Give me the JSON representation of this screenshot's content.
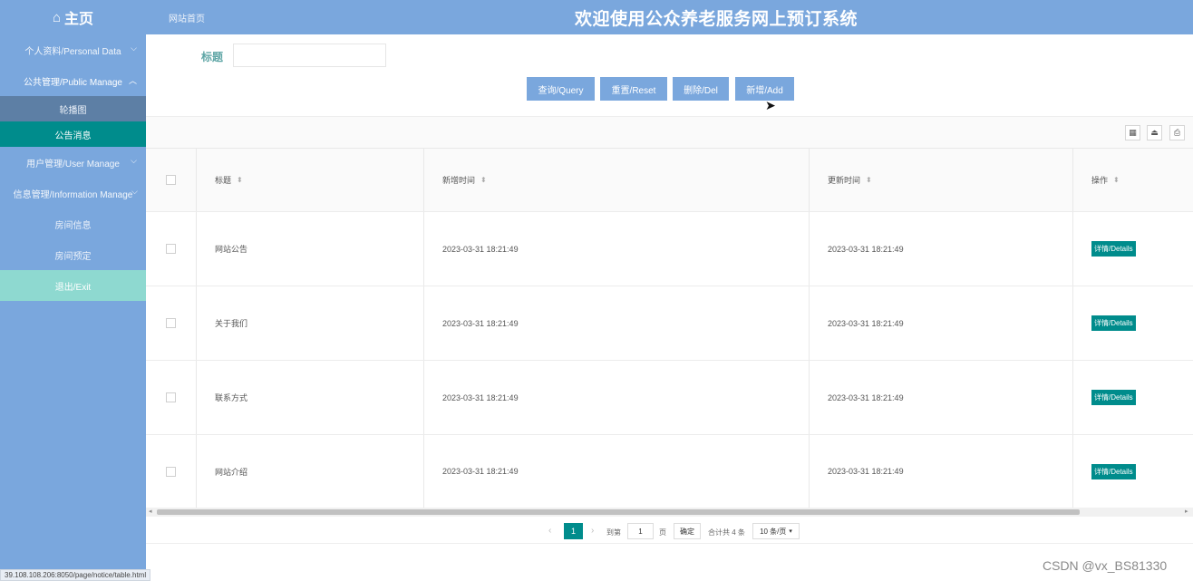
{
  "topbar": {
    "brand": "主页",
    "home_icon": "home-icon",
    "breadcrumb": "网站首页",
    "system_title": "欢迎使用公众养老服务网上预订系统"
  },
  "sidebar": {
    "items": [
      {
        "label": "个人资料/Personal Data",
        "chevron": "chevron-down-icon"
      },
      {
        "label": "公共管理/Public Manage",
        "chevron": "chevron-up-icon"
      },
      {
        "label": "轮播图"
      },
      {
        "label": "公告消息"
      },
      {
        "label": "用户管理/User Manage",
        "chevron": "chevron-down-icon"
      },
      {
        "label": "信息管理/Information Manage",
        "chevron": "chevron-down-icon"
      },
      {
        "label": "房间信息"
      },
      {
        "label": "房间预定"
      },
      {
        "label": "退出/Exit"
      }
    ]
  },
  "search": {
    "label": "标题",
    "value": "",
    "placeholder": ""
  },
  "buttons": {
    "query": "查询/Query",
    "reset": "重置/Reset",
    "delete": "删除/Del",
    "add": "新增/Add"
  },
  "toolbar": {
    "icons": [
      "grid-filter-icon",
      "export-icon",
      "print-icon"
    ]
  },
  "table": {
    "headers": {
      "title": "标题",
      "created": "新增时间",
      "updated": "更新时间",
      "actions": "操作"
    },
    "rows": [
      {
        "title": "网站公告",
        "created": "2023-03-31 18:21:49",
        "updated": "2023-03-31 18:21:49",
        "action": "详情/Details"
      },
      {
        "title": "关于我们",
        "created": "2023-03-31 18:21:49",
        "updated": "2023-03-31 18:21:49",
        "action": "详情/Details"
      },
      {
        "title": "联系方式",
        "created": "2023-03-31 18:21:49",
        "updated": "2023-03-31 18:21:49",
        "action": "详情/Details"
      },
      {
        "title": "网站介绍",
        "created": "2023-03-31 18:21:49",
        "updated": "2023-03-31 18:21:49",
        "action": "详情/Details"
      }
    ]
  },
  "pagination": {
    "current_page": "1",
    "goto_label": "到第",
    "goto_value": "1",
    "page_unit": "页",
    "confirm": "确定",
    "total": "合计共 4 条",
    "page_size": "10 条/页"
  },
  "status_bar": {
    "url": "39.108.108.206:8050/page/notice/table.html"
  },
  "watermark": "CSDN @vx_BS81330",
  "colors": {
    "header": "#7aa7dd",
    "accent": "#008c8c",
    "exit": "#8ed9d0"
  }
}
